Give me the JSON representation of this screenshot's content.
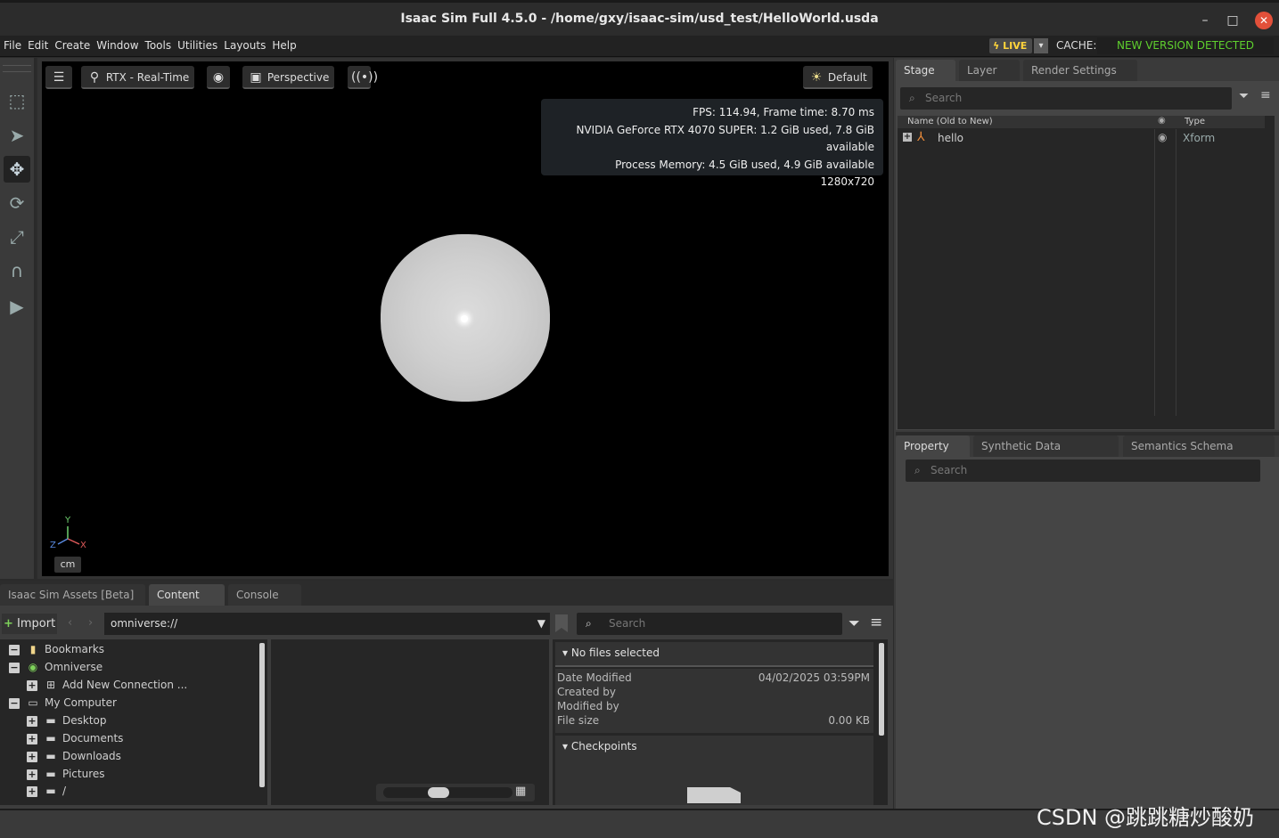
{
  "window": {
    "title": "Isaac Sim Full 4.5.0 - /home/gxy/isaac-sim/usd_test/HelloWorld.usda",
    "minimize": "–",
    "maximize": "□",
    "close": "✕"
  },
  "menubar": {
    "items": [
      "File",
      "Edit",
      "Create",
      "Window",
      "Tools",
      "Utilities",
      "Layouts",
      "Help"
    ],
    "live_label": "LIVE",
    "cache_label": "CACHE:",
    "new_version": "NEW VERSION DETECTED"
  },
  "viewport": {
    "renderer": "RTX - Real-Time",
    "camera": "Perspective",
    "lighting": "Default",
    "stats": {
      "fps": "FPS: 114.94, Frame time: 8.70 ms",
      "gpu": "NVIDIA GeForce RTX 4070 SUPER: 1.2 GiB used, 7.8 GiB available",
      "memory": "Process Memory: 4.5 GiB used, 4.9 GiB available",
      "resolution": "1280x720"
    },
    "units": "cm",
    "axes": {
      "y": "Y",
      "z": "Z",
      "x": "X"
    }
  },
  "stage_panel": {
    "tabs": [
      "Stage",
      "Layer",
      "Render Settings"
    ],
    "search_placeholder": "Search",
    "columns": {
      "name": "Name (Old to New)",
      "type": "Type"
    },
    "rows": [
      {
        "name": "hello",
        "type": "Xform"
      }
    ]
  },
  "property_panel": {
    "tabs": [
      "Property",
      "Synthetic Data Recorder",
      "Semantics Schema Editor"
    ],
    "search_placeholder": "Search"
  },
  "bottom_panel": {
    "tabs": [
      "Isaac Sim Assets [Beta]",
      "Content",
      "Console"
    ],
    "import_label": "Import",
    "path": "omniverse://",
    "search_placeholder": "Search",
    "tree": [
      {
        "label": "Bookmarks",
        "level": 0
      },
      {
        "label": "Omniverse",
        "level": 0
      },
      {
        "label": "Add New Connection ...",
        "level": 1
      },
      {
        "label": "My Computer",
        "level": 0
      },
      {
        "label": "Desktop",
        "level": 1
      },
      {
        "label": "Documents",
        "level": 1
      },
      {
        "label": "Downloads",
        "level": 1
      },
      {
        "label": "Pictures",
        "level": 1
      },
      {
        "label": "/",
        "level": 1
      }
    ],
    "details": {
      "header": "No files selected",
      "date_modified_label": "Date Modified",
      "date_modified_value": "04/02/2025 03:59PM",
      "created_by_label": "Created by",
      "modified_by_label": "Modified by",
      "file_size_label": "File size",
      "file_size_value": "0.00 KB",
      "checkpoints": "Checkpoints"
    }
  },
  "watermark": "CSDN @跳跳糖炒酸奶"
}
